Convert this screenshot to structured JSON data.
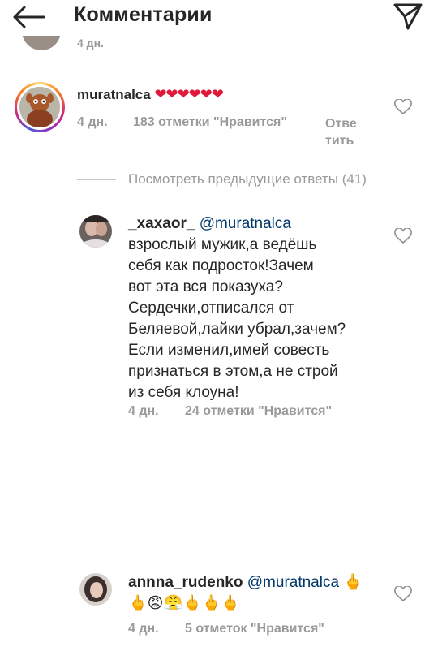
{
  "header": {
    "title": "Комментарии",
    "back_icon": "arrow-left-icon",
    "share_icon": "paper-plane-icon"
  },
  "previous": {
    "time": "4 дн."
  },
  "comment": {
    "username": "muratnalca",
    "hearts": "❤❤❤❤❤❤",
    "time": "4 дн.",
    "likes": "183 отметки \"Нравится\"",
    "reply_line1": "Отве",
    "reply_line2": "тить"
  },
  "view_previous": "Посмотреть предыдущие ответы (41)",
  "replies": [
    {
      "username": "_xaxaor_",
      "mention": "@muratnalca",
      "lines": [
        "взрослый мужик,а ведёшь",
        "себя как подросток!Зачем",
        "вот эта вся показуха?",
        "Сердечки,отписался от",
        "Беляевой,лайки убрал,зачем?",
        "Если изменил,имей совесть",
        "признаться в этом,а не строй",
        "из себя клоуна!"
      ],
      "time": "4 дн.",
      "likes": "24 отметки \"Нравится\""
    },
    {
      "username": "annna_rudenko",
      "mention": "@muratnalca",
      "emoji_tail": "🖕",
      "emoji_line": "🖕😡😤🖕🖕🖕",
      "time": "4 дн.",
      "likes": "5 отметок \"Нравится\""
    }
  ]
}
